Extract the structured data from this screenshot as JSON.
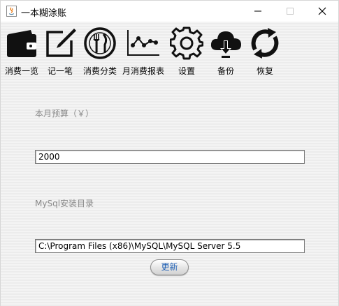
{
  "window": {
    "title": "一本糊涂账"
  },
  "toolbar": {
    "items": [
      {
        "label": "消费一览",
        "icon": "wallet-icon"
      },
      {
        "label": "记一笔",
        "icon": "edit-icon"
      },
      {
        "label": "消费分类",
        "icon": "fork-knife-icon"
      },
      {
        "label": "月消费报表",
        "icon": "line-chart-icon"
      },
      {
        "label": "设置",
        "icon": "gear-icon"
      },
      {
        "label": "备份",
        "icon": "cloud-download-icon"
      },
      {
        "label": "恢复",
        "icon": "refresh-icon"
      }
    ]
  },
  "settings": {
    "budget_label": "本月预算（￥）",
    "budget_value": "2000",
    "mysql_label": "MySql安装目录",
    "mysql_value": "C:\\Program Files (x86)\\MySQL\\MySQL Server 5.5",
    "update_button": "更新"
  },
  "colors": {
    "accent_text": "#1e5fb4",
    "label_gray": "#8a8a8a"
  }
}
